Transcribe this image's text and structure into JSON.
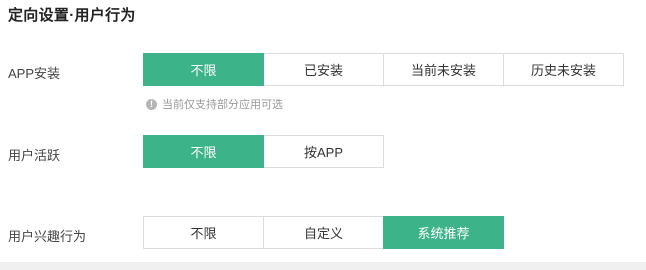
{
  "section_title": "定向设置·用户行为",
  "accent_color": "#3db38a",
  "app_install": {
    "label": "APP安装",
    "options": [
      "不限",
      "已安装",
      "当前未安装",
      "历史未安装"
    ],
    "selected": "不限",
    "hint": "当前仅支持部分应用可选",
    "hint_icon": "exclamation-circle-icon"
  },
  "user_active": {
    "label": "用户活跃",
    "options": [
      "不限",
      "按APP"
    ],
    "selected": "不限"
  },
  "user_interest": {
    "label": "用户兴趣行为",
    "options": [
      "不限",
      "自定义",
      "系统推荐"
    ],
    "selected": "系统推荐"
  }
}
